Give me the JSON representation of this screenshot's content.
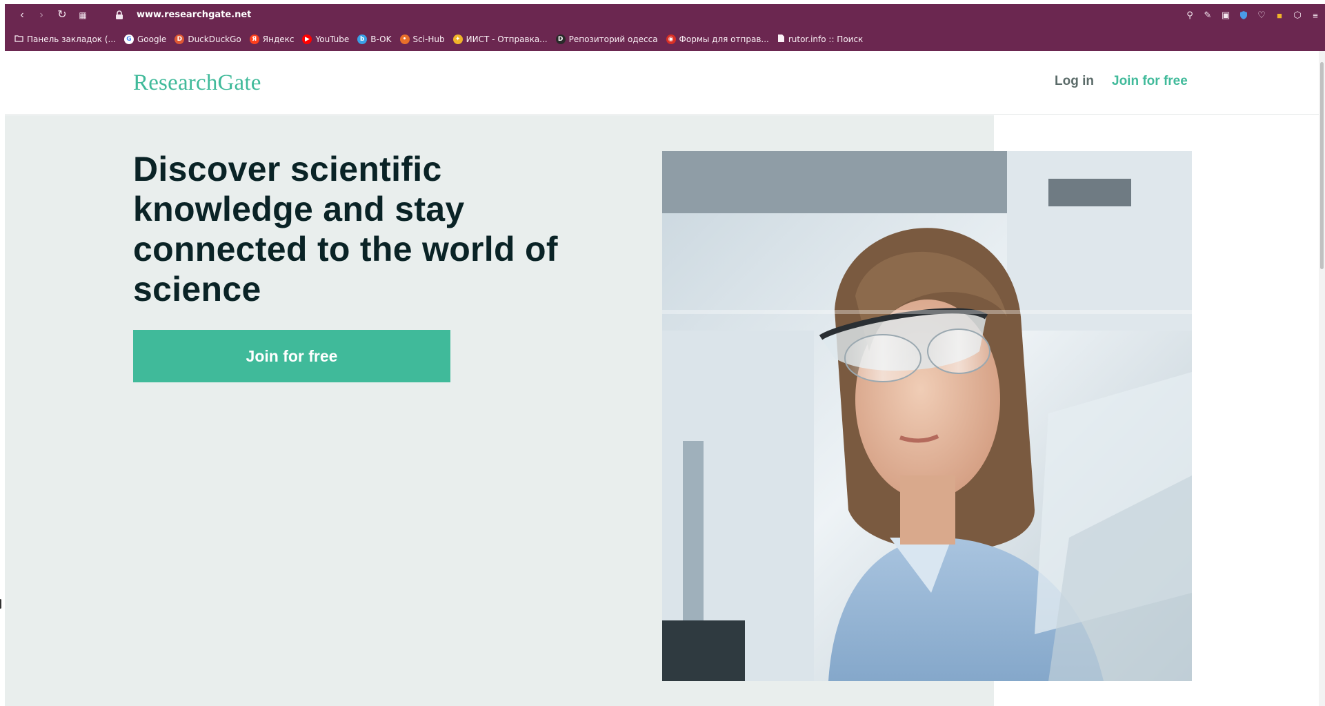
{
  "browser": {
    "url_host": "www.researchgate.net",
    "bookmarks": [
      {
        "label": "Панель закладок (...",
        "icon": "folder-icon"
      },
      {
        "label": "Google",
        "icon": "google-icon",
        "icon_glyph": "G",
        "color": "#ffffff"
      },
      {
        "label": "DuckDuckGo",
        "icon": "duckduckgo-icon",
        "icon_glyph": "D",
        "color": "#de5833"
      },
      {
        "label": "Яндекс",
        "icon": "yandex-icon",
        "icon_glyph": "Я",
        "color": "#fc3f1d"
      },
      {
        "label": "YouTube",
        "icon": "youtube-icon",
        "icon_glyph": "▶",
        "color": "#ff0000"
      },
      {
        "label": "B-OK",
        "icon": "bok-icon",
        "icon_glyph": "b",
        "color": "#3aa0e6"
      },
      {
        "label": "Sci-Hub",
        "icon": "scihub-icon",
        "icon_glyph": "•",
        "color": "#e8702a"
      },
      {
        "label": "ИИСТ - Отправка...",
        "icon": "iist-icon",
        "icon_glyph": "✦",
        "color": "#f0b429"
      },
      {
        "label": "Репозиторий одесса",
        "icon": "repository-icon",
        "icon_glyph": "D",
        "color": "#2a2a2a"
      },
      {
        "label": "Формы для отправ...",
        "icon": "forms-icon",
        "icon_glyph": "◉",
        "color": "#d93025"
      },
      {
        "label": "rutor.info :: Поиск",
        "icon": "document-icon"
      }
    ]
  },
  "header": {
    "logo": "ResearchGate",
    "login_label": "Log in",
    "join_label": "Join for free"
  },
  "hero": {
    "title": "Discover scientific knowledge and stay connected to the world of science",
    "cta_label": "Join for free"
  },
  "colors": {
    "brand": "#40ba9a",
    "chrome": "#6b2750",
    "hero_bg": "#e9eeed",
    "heading": "#0a2326"
  }
}
